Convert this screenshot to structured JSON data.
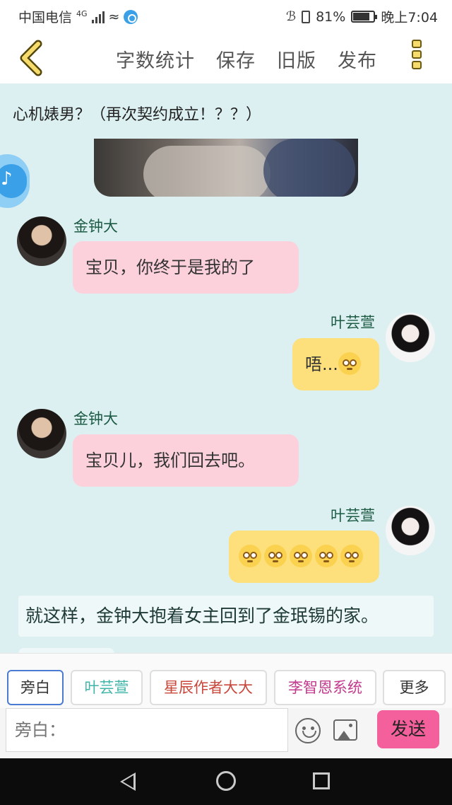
{
  "status_bar": {
    "carrier": "中国电信",
    "network": "4G",
    "battery": "81%",
    "battery_level": 0.81,
    "time": "晚上7:04"
  },
  "toolbar": {
    "word_count": "字数统计",
    "save": "保存",
    "old_version": "旧版",
    "publish": "发布"
  },
  "chat": {
    "title": "心机婊男？（再次契约成立！？？）",
    "messages": [
      {
        "sender": "金钟大",
        "text": "宝贝，你终于是我的了"
      },
      {
        "sender": "叶芸萱",
        "text": "唔..."
      },
      {
        "sender": "金钟大",
        "text": "宝贝儿，我们回去吧。"
      },
      {
        "sender": "叶芸萱",
        "text": ""
      }
    ],
    "narration": "就这样，金钟大抱着女主回到了金珉锡的家。"
  },
  "roles": [
    "旁白",
    "叶芸萱",
    "星辰作者大大",
    "李智恩系统",
    "更多"
  ],
  "role_colors": [
    "#333333",
    "#3fb5a8",
    "#c8473a",
    "#c13a8c",
    "#333333"
  ],
  "input": {
    "placeholder": "旁白：",
    "send": "发送"
  }
}
